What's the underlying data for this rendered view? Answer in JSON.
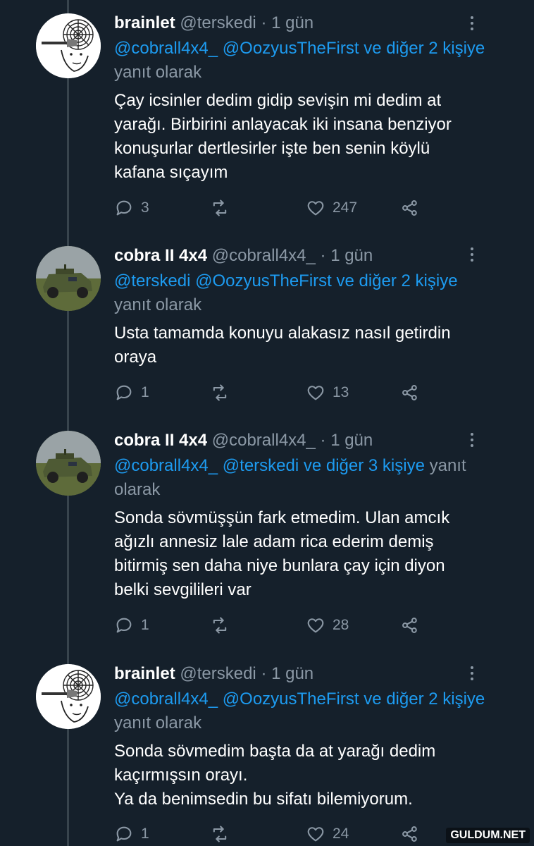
{
  "tweets": [
    {
      "name": "brainlet",
      "handle": "@terskedi",
      "time": "· 1 gün",
      "mentions": [
        "@cobrall4x4_",
        "@OozyusTheFirst",
        "ve diğer 2 kişiye"
      ],
      "reply_suffix": "yanıt olarak",
      "body": [
        "Çay icsinler dedim gidip sevişin mi dedim at",
        "yarağı. Birbirini anlayacak iki insana benziyor",
        "konuşurlar dertlesirler işte ben senin köylü",
        "kafana sıçayım"
      ],
      "replies": "3",
      "retweets": "",
      "likes": "247",
      "avatar": "wojak-avatar"
    },
    {
      "name": "cobra II 4x4",
      "handle": "@cobrall4x4_",
      "time": "· 1 gün",
      "mentions": [
        "@terskedi",
        "@OozyusTheFirst",
        "ve diğer 2 kişiye"
      ],
      "reply_suffix": "yanıt olarak",
      "body": [
        "Usta tamamda konuyu alakasız nasıl getirdin",
        "oraya"
      ],
      "replies": "1",
      "retweets": "",
      "likes": "13",
      "avatar": "armored-vehicle-avatar"
    },
    {
      "name": "cobra II 4x4",
      "handle": "@cobrall4x4_",
      "time": "· 1 gün",
      "mentions": [
        "@cobrall4x4_",
        "@terskedi",
        "ve diğer 3 kişiye"
      ],
      "reply_suffix": "yanıt olarak",
      "body": [
        "Sonda sövmüşşün fark etmedim. Ulan amcık",
        "ağızlı annesiz lale adam rica ederim demiş",
        "bitirmiş sen daha niye bunlara çay için diyon",
        "belki sevgilileri var"
      ],
      "replies": "1",
      "retweets": "",
      "likes": "28",
      "avatar": "armored-vehicle-avatar"
    },
    {
      "name": "brainlet",
      "handle": "@terskedi",
      "time": "· 1 gün",
      "mentions": [
        "@cobrall4x4_",
        "@OozyusTheFirst",
        "ve diğer 2 kişiye"
      ],
      "reply_suffix": "yanıt olarak",
      "body": [
        "Sonda sövmedim başta da at yarağı dedim",
        "kaçırmışsın orayı.",
        "Ya da benimsedin bu sifatı bilemiyorum."
      ],
      "replies": "1",
      "retweets": "",
      "likes": "24",
      "avatar": "wojak-avatar"
    }
  ],
  "watermark": "GULDUM.NET",
  "colors": {
    "background": "#15202b",
    "mention": "#1d9bf0",
    "muted": "#8b98a5",
    "thread_line": "#38444d"
  }
}
